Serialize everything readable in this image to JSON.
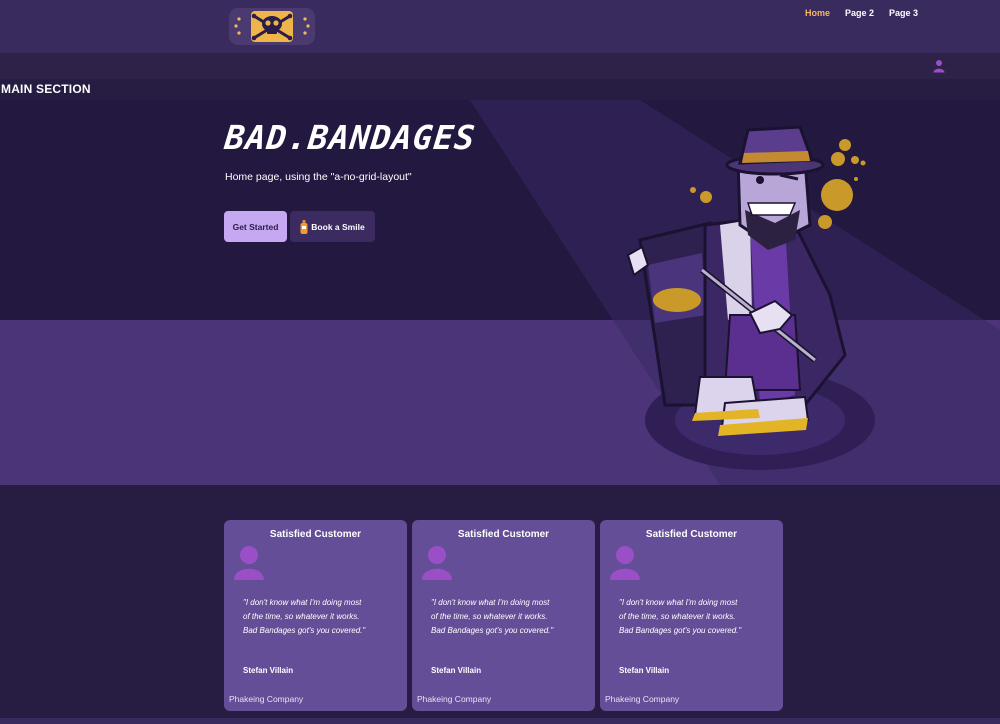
{
  "nav": {
    "items": [
      {
        "label": "Home",
        "active": true
      },
      {
        "label": "Page 2",
        "active": false
      },
      {
        "label": "Page 3",
        "active": false
      }
    ],
    "user_icon": "user-icon"
  },
  "logo": {
    "icon": "skull-crossbones-icon"
  },
  "main": {
    "section_title": "MAIN SECTION"
  },
  "hero": {
    "brand": "BAD.BANDAGES",
    "subtitle": "Home page, using the \"a-no-grid-layout\"",
    "primary_button": "Get Started",
    "secondary_button": "Book a Smile",
    "secondary_icon": "bottle-icon",
    "mascot": "villain-mascot-illustration"
  },
  "colors": {
    "accent": "#f4b860",
    "primary_button_bg": "#c6a7f2",
    "card_bg": "#644e98",
    "avatar": "#9b4fc7"
  },
  "testimonials": [
    {
      "title": "Satisfied Customer",
      "quote_line1": "\"I don't know what I'm doing most",
      "quote_line2": "of the time, so whatever it works.",
      "quote_line3": "Bad Bandages got's you covered.\"",
      "name": "Stefan Villain",
      "company": "Phakeing Company"
    },
    {
      "title": "Satisfied Customer",
      "quote_line1": "\"I don't know what I'm doing most",
      "quote_line2": "of the time, so whatever it works.",
      "quote_line3": "Bad Bandages got's you covered.\"",
      "name": "Stefan Villain",
      "company": "Phakeing Company"
    },
    {
      "title": "Satisfied Customer",
      "quote_line1": "\"I don't know what I'm doing most",
      "quote_line2": "of the time, so whatever it works.",
      "quote_line3": "Bad Bandages got's you covered.\"",
      "name": "Stefan Villain",
      "company": "Phakeing Company"
    }
  ]
}
